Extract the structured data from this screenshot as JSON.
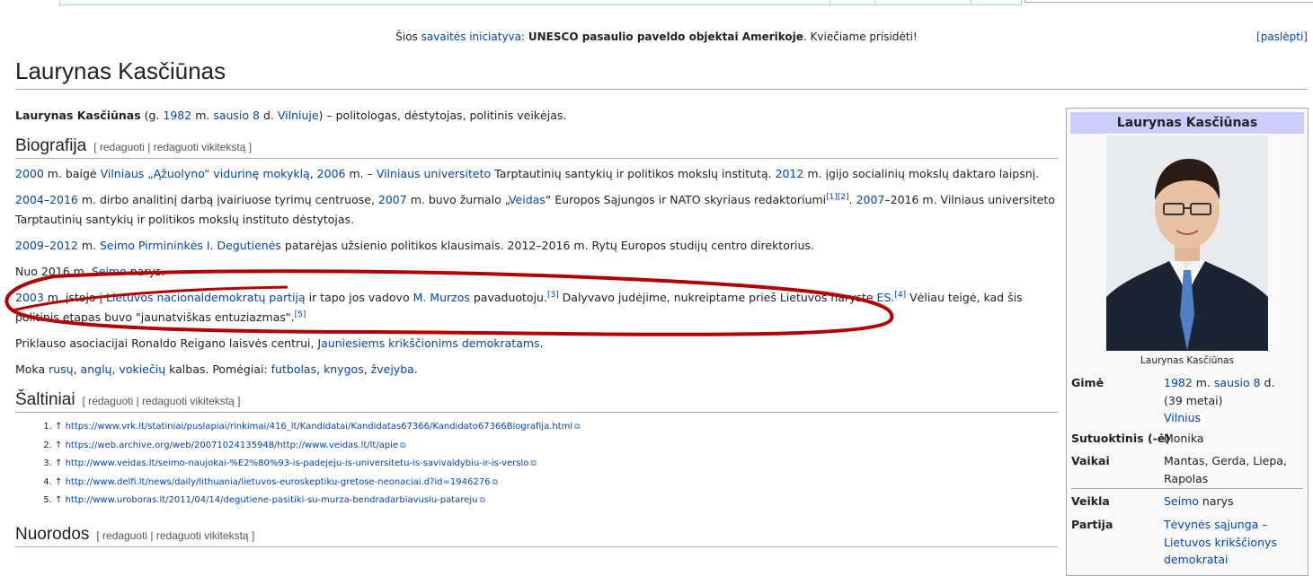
{
  "notice": {
    "prefix": "Šios",
    "link": "savaitės iniciatyva",
    "colon": ":",
    "bold": "UNESCO pasaulio paveldo objektai Amerikoje",
    "rest": ". Kviečiame prisidėti!",
    "hide": "[paslėpti]"
  },
  "title": "Laurynas Kasčiūnas",
  "lead": {
    "name": "Laurynas Kasčiūnas",
    "t1": " (g. ",
    "year": "1982",
    "t2": " m. ",
    "date": "sausio 8",
    "t3": " d. ",
    "city": "Vilniuje",
    "t4": ") – politologas, dėstytojas, politinis veikėjas."
  },
  "sections": {
    "bio": "Biografija",
    "sources": "Šaltiniai",
    "links": "Nuorodos",
    "edit": "[ redaguoti | redaguoti vikitekstą ]"
  },
  "bio": {
    "p1": {
      "y1": "2000",
      "t1": " m. baigė ",
      "school": "Vilniaus „Ąžuolyno“ vidurinę mokyklą",
      "t2": ", ",
      "y2": "2006",
      "t3": " m. – ",
      "uni": "Vilniaus universiteto",
      "t4": " Tarptautinių santykių ir politikos mokslų institutą. ",
      "y3": "2012",
      "t5": " m. įgijo socialinių mokslų daktaro laipsnį."
    },
    "p2": {
      "y1": "2004",
      "dash": "–",
      "y2": "2016",
      "t1": " m. dirbo analitinį darbą įvairiuose tyrimų centruose, ",
      "y3": "2007",
      "t2": " m. buvo žurnalo „",
      "mag": "Veidas",
      "t3": "“ Europos Sąjungos ir NATO skyriaus redaktoriumi",
      "ref": "[1][2]",
      "t4": ". ",
      "y4": "2007",
      "t5": "–2016 m. Vilniaus universiteto Tarptautinių santykių ir politikos mokslų instituto dėstytojas."
    },
    "p3": {
      "y1": "2009",
      "dash": "–",
      "y2": "2012",
      "t1": " m. ",
      "link": "Seimo Pirmininkės I. Degutienės",
      "t2": " patarėjas užsienio politikos klausimais. 2012–2016 m. Rytų Europos studijų centro direktorius."
    },
    "p4": {
      "t1": "Nuo 2016 m. ",
      "link": "Seimo",
      "t2": " narys."
    },
    "p5": {
      "y1": "2003",
      "t1": " m. įstojo į ",
      "party": "Lietuvos nacionaldemokratų partiją",
      "t2": " ir tapo jos vadovo ",
      "leader": "M. Murzos",
      "t3": " pavaduotoju.",
      "ref1": "[3]",
      "t4": " Dalyvavo judėjime, nukreiptame prieš Lietuvos narystę ",
      "es": "ES",
      "t5": ".",
      "ref2": "[4]",
      "t6": " Vėliau teigė, kad šis politinis etapas buvo \"jaunatviškas entuziazmas\".",
      "ref3": "[5]"
    },
    "p6": {
      "t1": "Priklauso asociacijai Ronaldo Reigano laisvės centrui, ",
      "link": "Jauniesiems krikščionims demokratams",
      "t2": "."
    },
    "p7": {
      "t1": "Moka ",
      "l1": "rusų",
      "c1": ", ",
      "l2": "anglų",
      "c2": ", ",
      "l3": "vokiečių",
      "t2": " kalbas. Pomėgiai: ",
      "h1": "futbolas",
      "c3": ", ",
      "h2": "knygos",
      "c4": ", ",
      "h3": "žvejyba",
      "t3": "."
    }
  },
  "references": [
    "https://www.vrk.lt/statiniai/puslapiai/rinkimai/416_lt/Kandidatai/Kandidatas67366/Kandidato67366Biografija.html",
    "https://web.archive.org/web/20071024135948/http://www.veidas.lt/lt/apie",
    "http://www.veidas.lt/seimo-naujokai-%E2%80%93-is-padejeju-is-universitetu-is-savivaldybiu-ir-is-verslo",
    "http://www.delfi.lt/news/daily/lithuania/lietuvos-euroskeptiku-gretose-neonaciai.d?id=1946276",
    "http://www.uroboras.lt/2011/04/14/degutiene-pasitiki-su-murza-bendradarbiavusiu-patareju"
  ],
  "ref_prefix": "↑",
  "infobox": {
    "title": "Laurynas Kasčiūnas",
    "caption": "Laurynas Kasčiūnas",
    "born_label": "Gimė",
    "born_year": "1982",
    "born_m": " m. ",
    "born_date": "sausio 8",
    "born_d": " d.",
    "born_age": "(39 metai)",
    "born_place": "Vilnius",
    "spouse_label": "Sutuoktinis (-ė)",
    "spouse": "Monika",
    "children_label": "Vaikai",
    "children": "Mantas, Gerda, Liepa, Rapolas",
    "activity_label": "Veikla",
    "activity_link": "Seimo",
    "activity_rest": " narys",
    "party_label": "Partija",
    "party": "Tėvynės sąjunga – Lietuvos krikščionys demokratai"
  }
}
